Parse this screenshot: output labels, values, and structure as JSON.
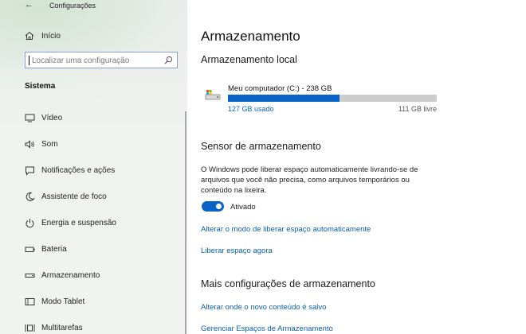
{
  "window": {
    "title": "Configurações",
    "back_icon": "back-arrow-icon"
  },
  "sidebar": {
    "home": {
      "label": "Início",
      "icon": "home-icon"
    },
    "search": {
      "placeholder": "Localizar uma configuração",
      "icon": "search-icon"
    },
    "section_title": "Sistema",
    "items": [
      {
        "label": "Vídeo",
        "icon": "monitor-icon"
      },
      {
        "label": "Som",
        "icon": "speaker-icon"
      },
      {
        "label": "Notificações e ações",
        "icon": "notification-icon"
      },
      {
        "label": "Assistente de foco",
        "icon": "moon-icon"
      },
      {
        "label": "Energia e suspensão",
        "icon": "power-icon"
      },
      {
        "label": "Bateria",
        "icon": "battery-icon"
      },
      {
        "label": "Armazenamento",
        "icon": "storage-icon"
      },
      {
        "label": "Modo Tablet",
        "icon": "tablet-icon"
      },
      {
        "label": "Multitarefas",
        "icon": "multitask-icon"
      }
    ]
  },
  "main": {
    "title": "Armazenamento",
    "local_storage": {
      "heading": "Armazenamento local",
      "drive_icon": "drive-icon",
      "drive_label": "Meu computador (C:) - 238 GB",
      "used_label": "127 GB usado",
      "free_label": "111 GB livre",
      "used_fraction": 0.534
    },
    "sensor": {
      "heading": "Sensor de armazenamento",
      "description": "O Windows pode liberar espaço automaticamente livrando-se de arquivos que você não precisa, como arquivos temporários ou conteúdo na lixeira.",
      "toggle_state": "Ativado",
      "links": [
        "Alterar o modo de liberar espaço automaticamente",
        "Liberar espaço agora"
      ]
    },
    "more": {
      "heading": "Mais configurações de armazenamento",
      "links": [
        "Alterar onde o novo conteúdo é salvo",
        "Gerenciar Espaços de Armazenamento"
      ]
    }
  },
  "colors": {
    "accent": "#0a64c8",
    "link": "#0a5fb4",
    "bar_track": "#cccccc"
  }
}
